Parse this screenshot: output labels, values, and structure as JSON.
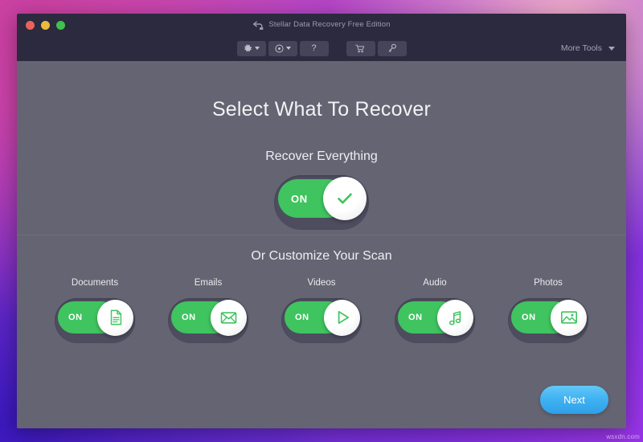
{
  "window": {
    "title": "Stellar Data Recovery Free Edition",
    "back_icon": "back-arrow-icon",
    "traffic_lights": [
      {
        "name": "close",
        "color": "#e8635c"
      },
      {
        "name": "minimize",
        "color": "#e9bb3e"
      },
      {
        "name": "zoom",
        "color": "#3fc14d"
      }
    ]
  },
  "toolbar": {
    "buttons": [
      {
        "id": "settings",
        "icon": "gear-icon",
        "has_caret": true
      },
      {
        "id": "media-type",
        "icon": "disc-icon",
        "has_caret": true
      },
      {
        "id": "help",
        "icon": "question-mark-icon",
        "label": "?",
        "has_caret": false
      },
      {
        "id": "buy",
        "icon": "shopping-cart-icon",
        "has_caret": false
      },
      {
        "id": "activate",
        "icon": "key-icon",
        "has_caret": false
      }
    ],
    "more_tools_label": "More Tools",
    "more_tools_caret": "chevron-down-icon"
  },
  "main": {
    "page_title": "Select What To Recover",
    "recover_everything": {
      "heading": "Recover Everything",
      "toggle_state": "ON",
      "toggle_label": "ON",
      "icon": "check-icon"
    },
    "customize": {
      "heading": "Or Customize Your Scan",
      "categories": [
        {
          "label": "Documents",
          "toggle_label": "ON",
          "state": "ON",
          "icon": "document-icon"
        },
        {
          "label": "Emails",
          "toggle_label": "ON",
          "state": "ON",
          "icon": "envelope-icon"
        },
        {
          "label": "Videos",
          "toggle_label": "ON",
          "state": "ON",
          "icon": "play-icon"
        },
        {
          "label": "Audio",
          "toggle_label": "ON",
          "state": "ON",
          "icon": "music-note-icon"
        },
        {
          "label": "Photos",
          "toggle_label": "ON",
          "state": "ON",
          "icon": "photo-icon"
        }
      ]
    },
    "next_button_label": "Next"
  },
  "watermark": "wsxdn.com",
  "colors": {
    "accent_green": "#3fc45f",
    "next_blue": "#3fb2f2",
    "window_body": "#646472",
    "titlebar": "#2b2a3e"
  }
}
